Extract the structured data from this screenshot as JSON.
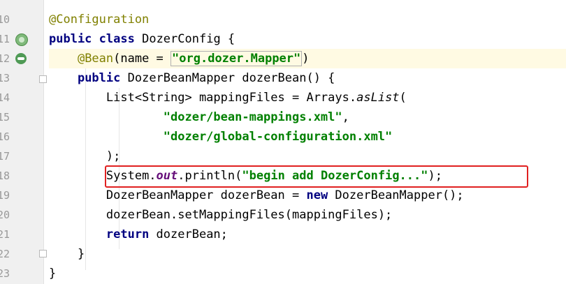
{
  "gutter": {
    "lines": [
      "10",
      "11",
      "12",
      "13",
      "14",
      "15",
      "16",
      "17",
      "18",
      "19",
      "20",
      "21",
      "22",
      "23"
    ]
  },
  "code": {
    "l10": {
      "annotation": "@Configuration"
    },
    "l11": {
      "kw1": "public",
      "kw2": "class",
      "rest": " DozerConfig {"
    },
    "l12": {
      "ann": "@Bean",
      "pre": "(name = ",
      "str": "\"org.dozer.Mapper\"",
      "post": ")"
    },
    "l13": {
      "kw": "public",
      "rest": " DozerBeanMapper dozerBean() {"
    },
    "l14": {
      "pre": "List<String> mappingFiles = Arrays.",
      "method": "asList",
      "post": "("
    },
    "l15": {
      "str": "\"dozer/bean-mappings.xml\"",
      "post": ","
    },
    "l16": {
      "str": "\"dozer/global-configuration.xml\""
    },
    "l17": {
      "text": ");"
    },
    "l18": {
      "pre": "System.",
      "field": "out",
      "mid": ".println(",
      "str": "\"begin add DozerConfig...\"",
      "post": ");"
    },
    "l19": {
      "pre": "DozerBeanMapper dozerBean = ",
      "kw": "new",
      "post": " DozerBeanMapper();"
    },
    "l20": {
      "text": "dozerBean.setMappingFiles(mappingFiles);"
    },
    "l21": {
      "kw": "return",
      "post": " dozerBean;"
    },
    "l22": {
      "text": "}"
    },
    "l23": {
      "text": "}"
    }
  },
  "colors": {
    "keyword": "#000080",
    "annotation": "#808000",
    "string": "#008000",
    "static_field": "#660e7a",
    "highlight_box": "#e02020",
    "current_line": "#fffae3"
  },
  "icons": [
    "bean-icon",
    "navigate-bean-icon",
    "fold-marker-icon"
  ]
}
